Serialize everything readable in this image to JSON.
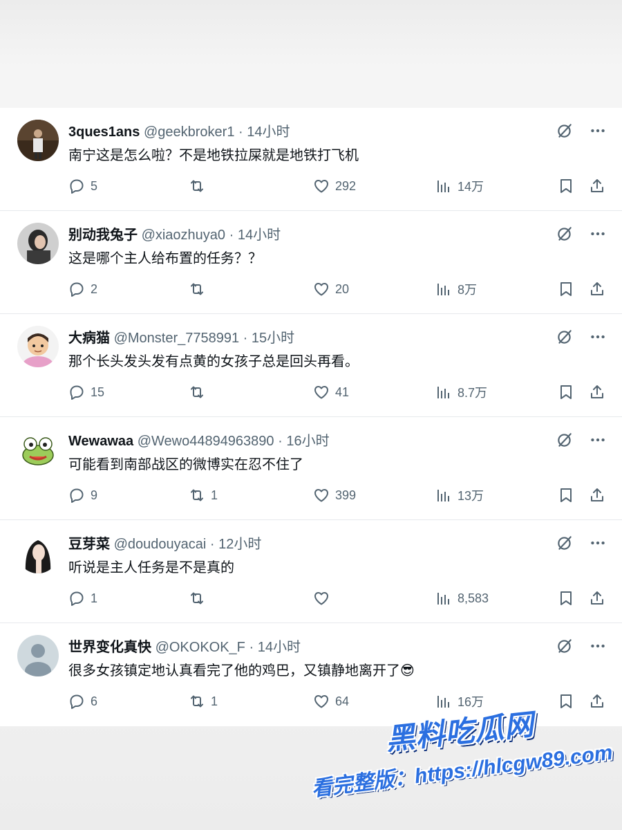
{
  "tweets": [
    {
      "name": "3ques1ans",
      "handle": "@geekbroker1",
      "dot": "·",
      "time": "14小时",
      "text": "南宁这是怎么啦？不是地铁拉屎就是地铁打飞机",
      "replies": "5",
      "retweets": "",
      "likes": "292",
      "views": "14万",
      "avatar": "avatar-man-dark"
    },
    {
      "name": "别动我兔子",
      "handle": "@xiaozhuya0",
      "dot": "·",
      "time": "14小时",
      "text": "这是哪个主人给布置的任务？？",
      "replies": "2",
      "retweets": "",
      "likes": "20",
      "views": "8万",
      "avatar": "avatar-woman-photo"
    },
    {
      "name": "大病猫",
      "handle": "@Monster_7758991",
      "dot": "·",
      "time": "15小时",
      "text": "那个长头发头发有点黄的女孩子总是回头再看。",
      "replies": "15",
      "retweets": "",
      "likes": "41",
      "views": "8.7万",
      "avatar": "avatar-cartoon-boy"
    },
    {
      "name": "Wewawaa",
      "handle": "@Wewo44894963890",
      "dot": "·",
      "time": "16小时",
      "text": "可能看到南部战区的微博实在忍不住了",
      "replies": "9",
      "retweets": "1",
      "likes": "399",
      "views": "13万",
      "avatar": "avatar-frog"
    },
    {
      "name": "豆芽菜",
      "handle": "@doudouyacai",
      "dot": "·",
      "time": "12小时",
      "text": "听说是主人任务是不是真的",
      "replies": "1",
      "retweets": "",
      "likes": "",
      "views": "8,583",
      "avatar": "avatar-anime-girl"
    },
    {
      "name": "世界变化真快",
      "handle": "@OKOKOK_F",
      "dot": "·",
      "time": "14小时",
      "text": "很多女孩镇定地认真看完了他的鸡巴，又镇静地离开了😎",
      "replies": "6",
      "retweets": "1",
      "likes": "64",
      "views": "16万",
      "avatar": "avatar-default"
    }
  ],
  "watermark": {
    "title": "黑料吃瓜网",
    "url": "看完整版：https://hlcgw89.com"
  },
  "colors": {
    "text": "#0f1419",
    "muted": "#536471",
    "divider": "#e6e9ec",
    "watermark": "#2b6fe0"
  }
}
